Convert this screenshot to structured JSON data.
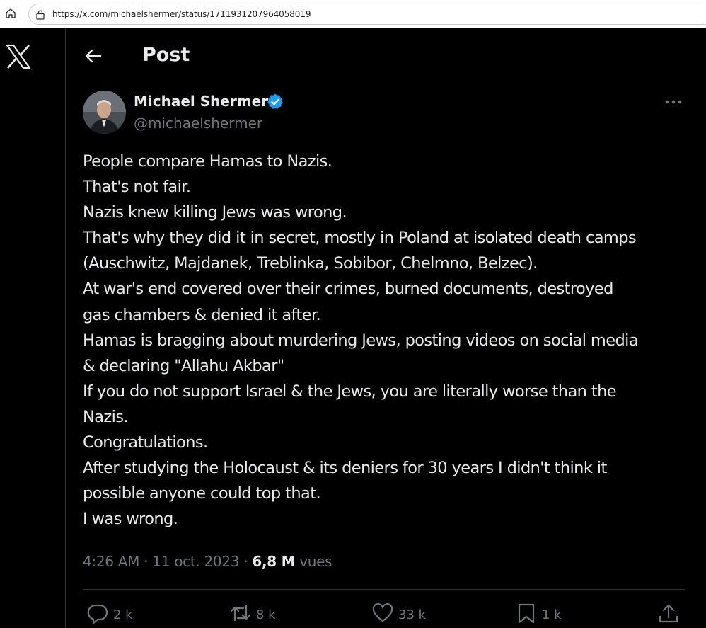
{
  "browser": {
    "url": "https://x.com/michaelshermer/status/1711931207964058019"
  },
  "header": {
    "title": "Post"
  },
  "author": {
    "name": "Michael Shermer",
    "handle": "@michaelshermer",
    "verified": true
  },
  "tweet": {
    "lines": [
      "People compare Hamas to Nazis.",
      "That's not fair.",
      "Nazis knew killing Jews was wrong.",
      "That's why they did it in secret, mostly in Poland at isolated death camps",
      "(Auschwitz, Majdanek, Treblinka, Sobibor, Chelmno, Belzec).",
      "At war's end covered over their crimes, burned documents, destroyed",
      "gas chambers & denied it after.",
      "Hamas is bragging about murdering Jews, posting videos on social media",
      "& declaring \"Allahu Akbar\"",
      "If you do not support Israel & the Jews, you are literally worse than the",
      "Nazis.",
      "Congratulations.",
      "After studying the Holocaust & its deniers for 30 years I didn't think it",
      "possible anyone could top that.",
      "I was wrong."
    ],
    "time": "4:26 AM",
    "separator": "·",
    "date": "11 oct. 2023",
    "views_count": "6,8 M",
    "views_label": "vues"
  },
  "actions": {
    "replies": "2 k",
    "reposts": "8 k",
    "likes": "33 k",
    "bookmarks": "1 k"
  },
  "colors": {
    "background": "#000000",
    "text": "#e7e9ea",
    "muted": "#71767b",
    "verified": "#1d9bf0",
    "border": "#2f3336"
  },
  "icons": [
    "home-icon",
    "lock-icon",
    "x-logo-icon",
    "back-arrow-icon",
    "verified-badge-icon",
    "more-icon",
    "reply-icon",
    "repost-icon",
    "like-icon",
    "bookmark-icon",
    "share-icon"
  ]
}
